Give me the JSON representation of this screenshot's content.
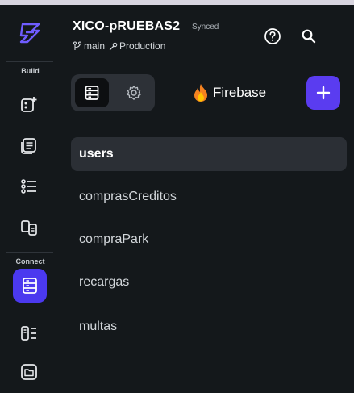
{
  "header": {
    "project_name": "XICO-pRUEBAS2",
    "sync_status": "Synced",
    "branch": "main",
    "environment": "Production"
  },
  "rail": {
    "sections": {
      "build": "Build",
      "connect": "Connect"
    },
    "items": [
      {
        "icon": "add-widget-icon"
      },
      {
        "icon": "pages-icon"
      },
      {
        "icon": "list-icon"
      },
      {
        "icon": "components-icon"
      },
      {
        "icon": "database-icon",
        "active": true
      },
      {
        "icon": "api-icon"
      },
      {
        "icon": "storage-icon"
      }
    ]
  },
  "toolbar": {
    "firebase_label": "Firebase",
    "add_label": "+"
  },
  "collections": {
    "items": [
      {
        "label": "users",
        "selected": true
      },
      {
        "label": "comprasCreditos"
      },
      {
        "label": "compraPark"
      },
      {
        "label": "recargas"
      },
      {
        "label": "multas"
      }
    ]
  },
  "colors": {
    "background": "#14181b",
    "accent": "#4b39ef",
    "add_button": "#5a3cf0",
    "selected_row": "#2b2f35",
    "firebase_orange": "#f58220",
    "firebase_yellow": "#ffc400"
  }
}
